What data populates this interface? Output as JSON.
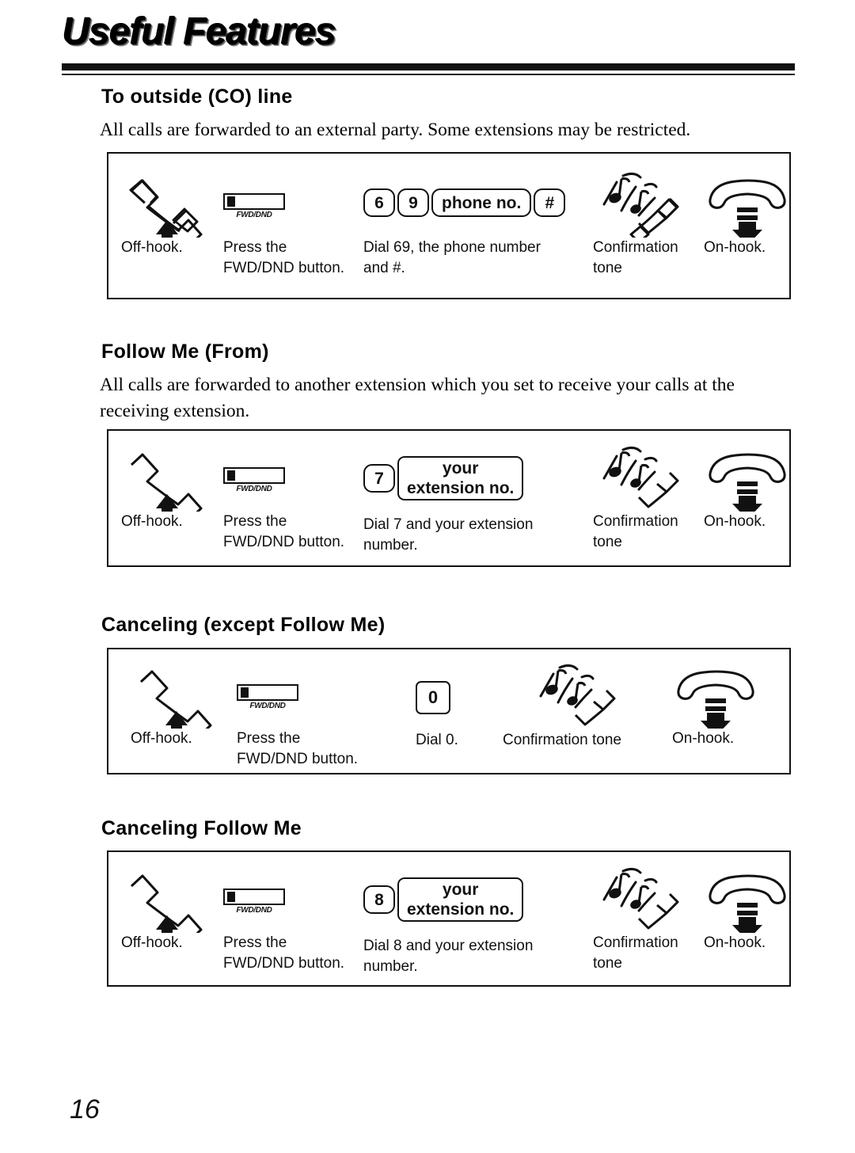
{
  "page": {
    "title": "Useful Features",
    "number": "16"
  },
  "sections": [
    {
      "heading": "To outside (CO) line",
      "body": "All calls are forwarded to an external party. Some extensions may be restricted.",
      "steps": [
        {
          "icon": "off-hook-handset-icon",
          "caption": "Off-hook."
        },
        {
          "icon": "fwd-dnd-button-icon",
          "button_label": "FWD/DND",
          "caption": "Press the\nFWD/DND button."
        },
        {
          "icon": "keypad-keys-icon",
          "keys": [
            "6",
            "9",
            "phone no.",
            "#"
          ],
          "caption": "Dial 69, the phone number\nand #."
        },
        {
          "icon": "confirmation-tone-icon",
          "caption": "Confirmation\ntone"
        },
        {
          "icon": "on-hook-handset-icon",
          "caption": "On-hook."
        }
      ]
    },
    {
      "heading": "Follow Me (From)",
      "body": "All calls are forwarded to another extension which you set to receive your calls at the receiving extension.",
      "steps": [
        {
          "icon": "off-hook-handset-icon",
          "caption": "Off-hook."
        },
        {
          "icon": "fwd-dnd-button-icon",
          "button_label": "FWD/DND",
          "caption": "Press the\nFWD/DND button."
        },
        {
          "icon": "keypad-keys-icon",
          "keys": [
            "7"
          ],
          "key_two_line": [
            "your",
            "extension no."
          ],
          "caption": "Dial 7 and your extension\nnumber."
        },
        {
          "icon": "confirmation-tone-icon",
          "caption": "Confirmation\ntone"
        },
        {
          "icon": "on-hook-handset-icon",
          "caption": "On-hook."
        }
      ]
    },
    {
      "heading": "Canceling (except Follow Me)",
      "body": "",
      "steps": [
        {
          "icon": "off-hook-handset-icon",
          "caption": "Off-hook."
        },
        {
          "icon": "fwd-dnd-button-icon",
          "button_label": "FWD/DND",
          "caption": "Press the\nFWD/DND button."
        },
        {
          "icon": "keypad-keys-icon",
          "keys": [
            "0"
          ],
          "caption": "Dial 0."
        },
        {
          "icon": "confirmation-tone-icon",
          "caption": "Confirmation tone"
        },
        {
          "icon": "on-hook-handset-icon",
          "caption": "On-hook."
        }
      ]
    },
    {
      "heading": "Canceling Follow Me",
      "body": "",
      "steps": [
        {
          "icon": "off-hook-handset-icon",
          "caption": "Off-hook."
        },
        {
          "icon": "fwd-dnd-button-icon",
          "button_label": "FWD/DND",
          "caption": "Press the\nFWD/DND button."
        },
        {
          "icon": "keypad-keys-icon",
          "keys": [
            "8"
          ],
          "key_two_line": [
            "your",
            "extension no."
          ],
          "caption": "Dial 8 and your extension\nnumber."
        },
        {
          "icon": "confirmation-tone-icon",
          "caption": "Confirmation\ntone"
        },
        {
          "icon": "on-hook-handset-icon",
          "caption": "On-hook."
        }
      ]
    }
  ]
}
